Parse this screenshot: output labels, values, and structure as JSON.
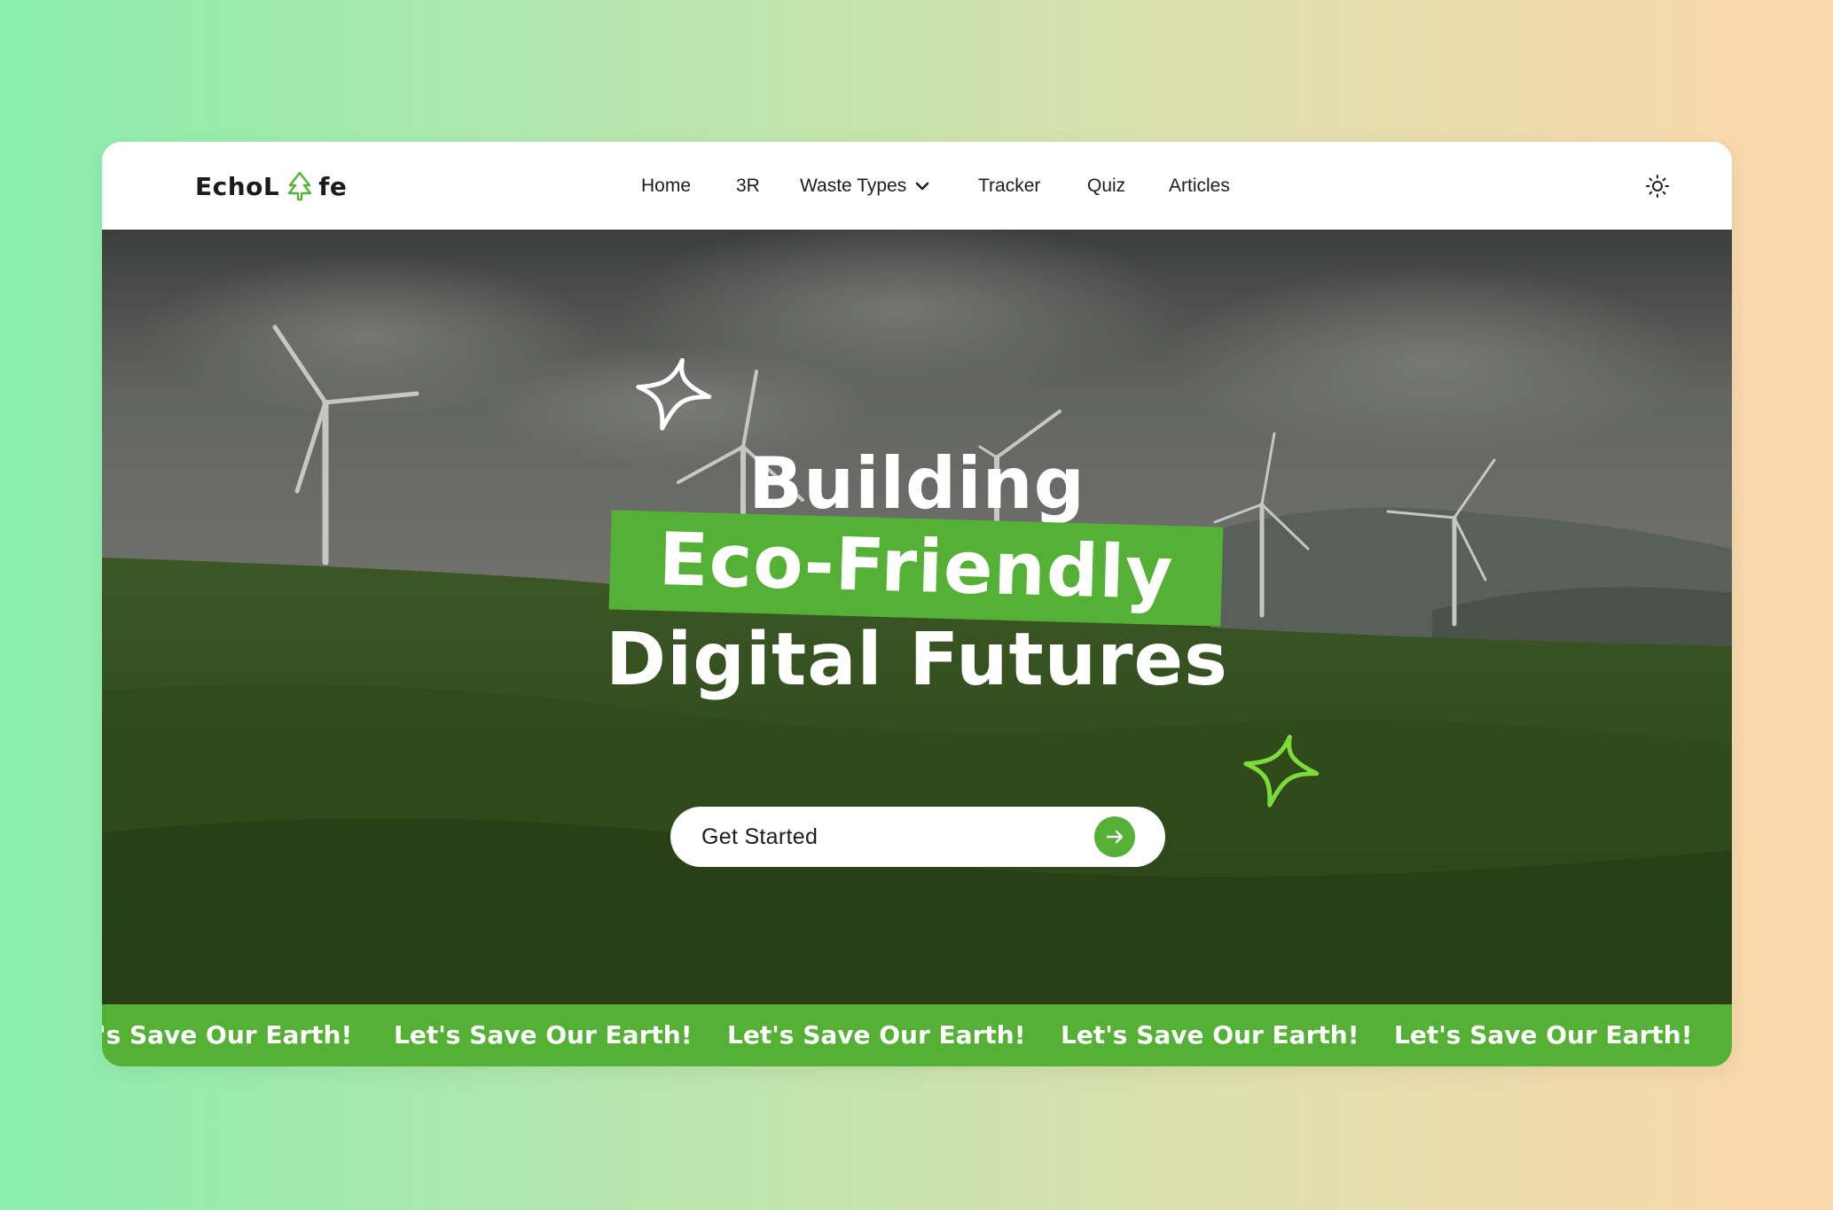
{
  "brand": {
    "name_part1": "EchoL",
    "name_part2": "fe",
    "logo_icon": "tree-icon",
    "accent_color": "#55b136"
  },
  "nav": {
    "items": [
      {
        "label": "Home"
      },
      {
        "label": "3R"
      },
      {
        "label": "Waste Types",
        "has_dropdown": true
      },
      {
        "label": "Tracker"
      },
      {
        "label": "Quiz"
      },
      {
        "label": "Articles"
      }
    ],
    "theme_toggle_icon": "sun-icon"
  },
  "hero": {
    "headline_line1": "Building",
    "headline_line2": "Eco-Friendly",
    "headline_line3": "Digital Futures",
    "cta_label": "Get Started",
    "cta_icon": "arrow-right-icon"
  },
  "marquee": {
    "items": [
      "'s Save Our Earth!",
      "Let's Save Our Earth!",
      "Let's Save Our Earth!",
      "Let's Save Our Earth!",
      "Let's Save Our Earth!"
    ]
  }
}
